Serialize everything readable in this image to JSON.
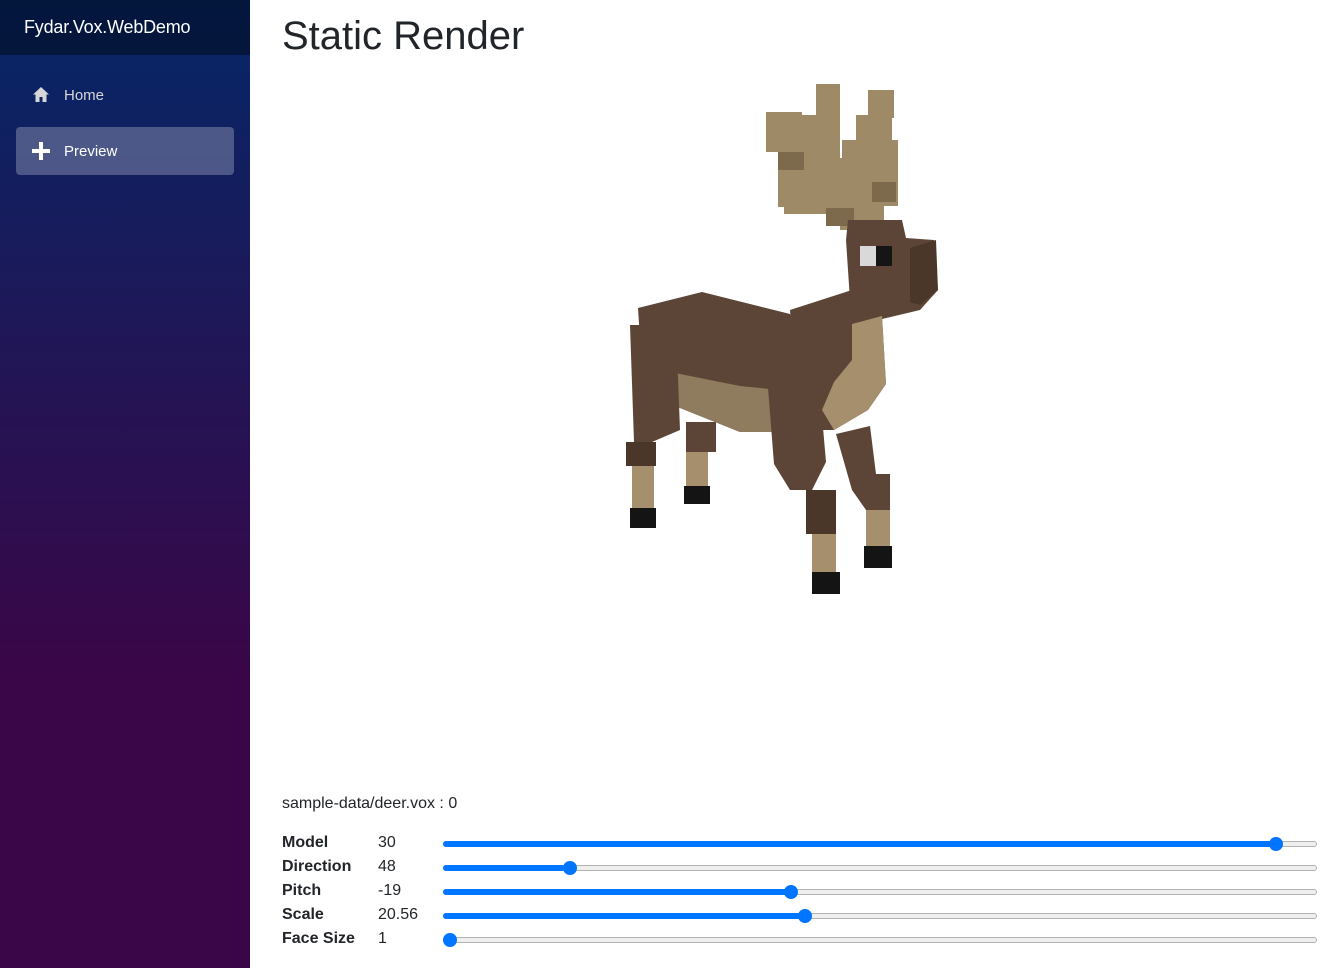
{
  "app": {
    "brand": "Fydar.Vox.WebDemo"
  },
  "nav": {
    "items": [
      {
        "label": "Home",
        "icon": "home-icon",
        "active": false
      },
      {
        "label": "Preview",
        "icon": "plus-icon",
        "active": true
      }
    ]
  },
  "page": {
    "title": "Static Render",
    "file_label": "sample-data/deer.vox : 0"
  },
  "render": {
    "subject": "voxel-deer-model",
    "colors": {
      "dark": "#5c4536",
      "light": "#a58f6c",
      "antler": "#9e8a66",
      "hoof": "#141414"
    }
  },
  "controls": [
    {
      "name": "Model",
      "value": "30",
      "fraction": 0.96
    },
    {
      "name": "Direction",
      "value": "48",
      "fraction": 0.14
    },
    {
      "name": "Pitch",
      "value": "-19",
      "fraction": 0.396
    },
    {
      "name": "Scale",
      "value": "20.56",
      "fraction": 0.413
    },
    {
      "name": "Face Size",
      "value": "1",
      "fraction": 0.0
    }
  ],
  "accent": "#0075ff"
}
